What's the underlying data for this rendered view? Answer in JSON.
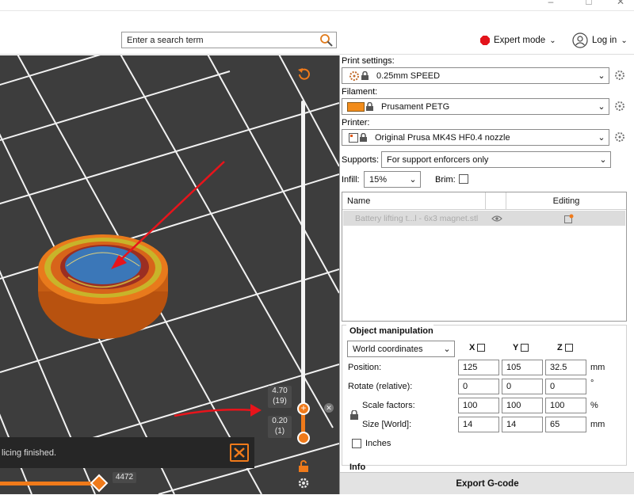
{
  "topbar": {
    "search_placeholder": "Enter a search term",
    "expert_mode_label": "Expert mode",
    "login_label": "Log in"
  },
  "settings": {
    "print_settings_label": "Print settings:",
    "print_settings_value": "0.25mm SPEED",
    "filament_label": "Filament:",
    "filament_value": "Prusament PETG",
    "filament_color": "#f28c1b",
    "printer_label": "Printer:",
    "printer_value": "Original Prusa MK4S HF0.4 nozzle",
    "supports_label": "Supports:",
    "supports_value": "For support enforcers only",
    "infill_label": "Infill:",
    "infill_value": "15%",
    "brim_label": "Brim:"
  },
  "object_list": {
    "col_name": "Name",
    "col_editing": "Editing",
    "rows": [
      {
        "name": "Battery lifting t...l - 6x3 magnet.stl"
      }
    ]
  },
  "manipulation": {
    "title": "Object manipulation",
    "coordinates": "World coordinates",
    "axes": [
      "X",
      "Y",
      "Z"
    ],
    "position_label": "Position:",
    "position": [
      "125",
      "105",
      "32.5"
    ],
    "position_unit": "mm",
    "rotate_label": "Rotate (relative):",
    "rotate": [
      "0",
      "0",
      "0"
    ],
    "rotate_unit": "°",
    "scale_label": "Scale factors:",
    "scale": [
      "100",
      "100",
      "100"
    ],
    "scale_unit": "%",
    "size_label": "Size [World]:",
    "size": [
      "14",
      "14",
      "65"
    ],
    "size_unit": "mm",
    "inches_label": "Inches",
    "info_label": "Info"
  },
  "export_label": "Export G-code",
  "viewport": {
    "notification": "licing finished.",
    "layer_top_height": "4.70",
    "layer_top_index": "(19)",
    "layer_bottom_height": "0.20",
    "layer_bottom_index": "(1)",
    "horizontal_value": "4472",
    "accent_color": "#f07a1a"
  }
}
